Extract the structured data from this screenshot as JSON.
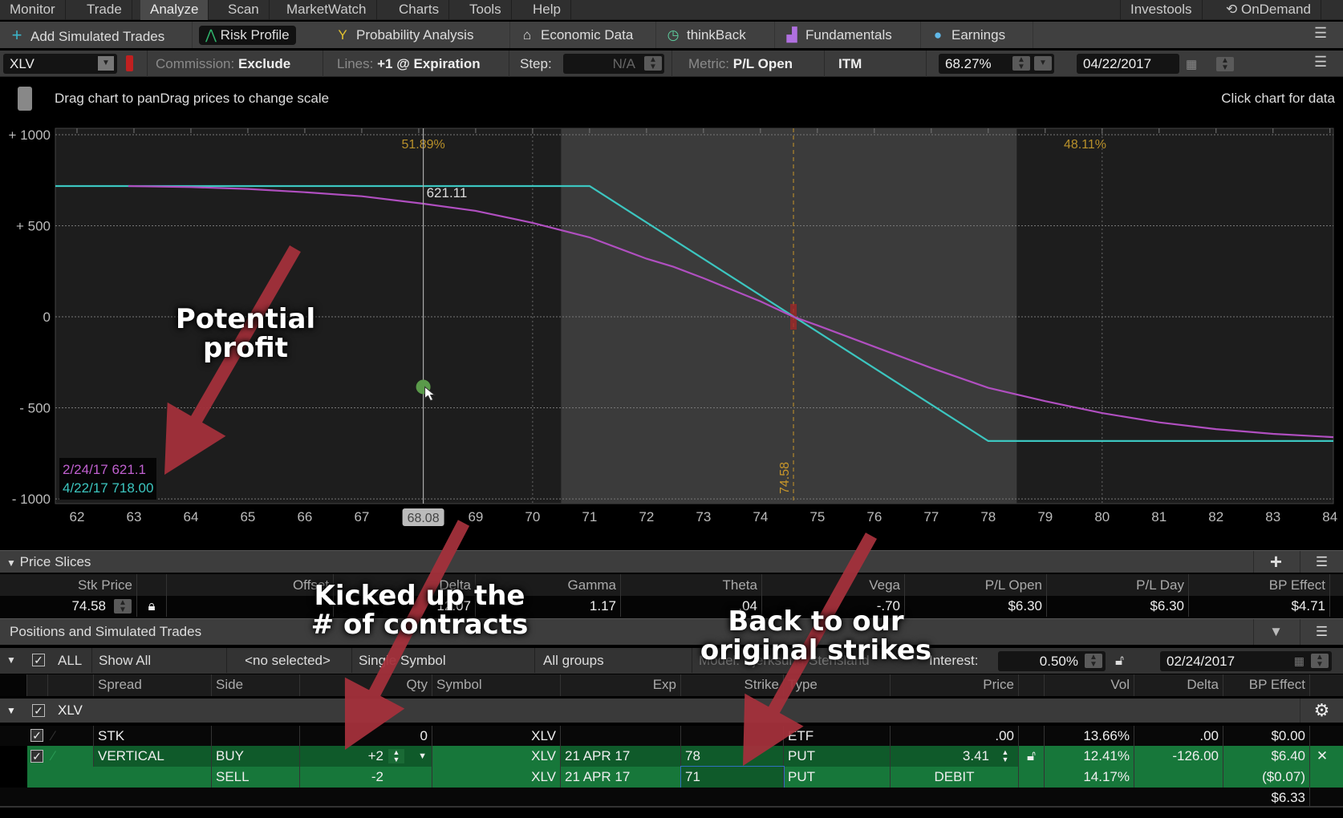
{
  "menu": {
    "tabs": [
      "Monitor",
      "Trade",
      "Analyze",
      "Scan",
      "MarketWatch",
      "Charts",
      "Tools",
      "Help"
    ],
    "active": "Analyze",
    "right": [
      "Investools",
      "OnDemand"
    ]
  },
  "toolbar": {
    "items": [
      "Add Simulated Trades",
      "Risk Profile",
      "Probability Analysis",
      "Economic Data",
      "thinkBack",
      "Fundamentals",
      "Earnings"
    ]
  },
  "options": {
    "symbol": "XLV",
    "commission_label": "Commission:",
    "commission_value": "Exclude",
    "lines_label": "Lines:",
    "lines_value": "+1 @ Expiration",
    "step_label": "Step:",
    "step_value": "N/A",
    "metric_label": "Metric:",
    "metric_value": "P/L Open",
    "itm": "ITM",
    "probability": "68.27%",
    "date": "04/22/2017"
  },
  "chart_header": {
    "hint": "Drag chart to panDrag prices to change scale",
    "right": "Click chart for data"
  },
  "chart_data": {
    "type": "line",
    "xlim": [
      61.62,
      84.06
    ],
    "ylim": [
      -1026,
      1035
    ],
    "x_ticks": [
      62,
      63,
      64,
      65,
      66,
      67,
      68,
      69,
      70,
      71,
      72,
      73,
      74,
      75,
      76,
      77,
      78,
      79,
      80,
      81,
      82,
      83,
      84
    ],
    "x_tick_labels": [
      "62",
      "63",
      "64",
      "65",
      "66",
      "67",
      "",
      "69",
      "70",
      "71",
      "72",
      "73",
      "74",
      "75",
      "76",
      "77",
      "78",
      "79",
      "80",
      "81",
      "82",
      "83",
      "84"
    ],
    "y_ticks": [
      1000,
      500,
      0,
      -500,
      -1000
    ],
    "y_tick_labels": [
      "+ 1000",
      "+ 500",
      "0",
      "- 500",
      "- 1000"
    ],
    "shaded_range": [
      70.5,
      78.5
    ],
    "grid_x": [
      70,
      80
    ],
    "stock_price": 74.58,
    "stock_price_label": "74.58",
    "crosshair_x": 68.08,
    "crosshair_label": "68.08",
    "crosshair_value_label": "621.11",
    "cursor_point": {
      "x": 68.08,
      "y": -385
    },
    "prob_labels": [
      {
        "x": 68.08,
        "text": "51.89%"
      },
      {
        "x": 79.7,
        "text": "48.11%"
      }
    ],
    "series": [
      {
        "name": "4/22/17",
        "color": "#3cc6c0",
        "x": [
          61.62,
          71,
          78,
          84.06
        ],
        "y": [
          718,
          718,
          -682,
          -682
        ]
      },
      {
        "name": "2/24/17",
        "color": "#b04fc0",
        "x": [
          62.9,
          64,
          65,
          66,
          67,
          68.08,
          69,
          70,
          71,
          72,
          72.47,
          73,
          74,
          74.58,
          75,
          76,
          77,
          78,
          79,
          80,
          81,
          82,
          83,
          84.06
        ],
        "y": [
          718,
          712,
          702,
          684,
          662,
          621,
          582,
          516,
          436,
          319,
          275,
          212,
          85,
          0,
          -47,
          -164,
          -281,
          -390,
          -463,
          -529,
          -580,
          -617,
          -643,
          -661
        ]
      }
    ],
    "legend": [
      {
        "text": "2/24/17 621.1",
        "color": "#c060d0"
      },
      {
        "text": "4/22/17 718.00",
        "color": "#3cc6c0"
      }
    ]
  },
  "price_slices": {
    "title": "Price Slices",
    "headers": [
      "Stk Price",
      "Offset",
      "Delta",
      "Gamma",
      "Theta",
      "Vega",
      "P/L Open",
      "P/L Day",
      "BP Effect"
    ],
    "values": {
      "stk_price": "74.58",
      "delta": "12.07",
      "gamma": "1.17",
      "theta": ".04",
      "vega": "-.70",
      "pl_open": "$6.30",
      "pl_day": "$6.30",
      "bp_effect": "$4.71"
    }
  },
  "positions": {
    "title": "Positions and Simulated Trades",
    "filters": {
      "all": "ALL",
      "show": "Show All",
      "selected": "<no selected>",
      "symbol": "Single Symbol",
      "groups": "All groups",
      "model": "Model: Bjerksund-Stensland",
      "interest_label": "Interest:",
      "interest": "0.50%",
      "date": "02/24/2017"
    },
    "headers": [
      "Spread",
      "Side",
      "Qty",
      "Symbol",
      "Exp",
      "Strike",
      "Type",
      "Price",
      "Vol",
      "Delta",
      "BP Effect"
    ],
    "group": "XLV",
    "rows": [
      {
        "spread": "STK",
        "side": "",
        "qty": "0",
        "symbol": "XLV",
        "exp": "",
        "strike": "",
        "type": "ETF",
        "price": ".00",
        "vol": "13.66%",
        "delta": ".00",
        "bp": "$0.00"
      },
      {
        "spread": "VERTICAL",
        "side": "BUY",
        "qty": "+2",
        "symbol": "XLV",
        "exp": "21 APR 17",
        "strike": "78",
        "type": "PUT",
        "price": "3.41",
        "vol": "12.41%",
        "delta": "-126.00",
        "bp": "$6.40"
      },
      {
        "spread": "",
        "side": "SELL",
        "qty": "-2",
        "symbol": "XLV",
        "exp": "21 APR 17",
        "strike": "71",
        "type": "PUT",
        "price": "DEBIT",
        "vol": "14.17%",
        "delta": "",
        "bp": "($0.07)"
      }
    ],
    "total_bp": "$6.33"
  },
  "annotations": {
    "potential_profit": [
      "Potential",
      "profit"
    ],
    "contracts": [
      "Kicked up the",
      "# of contracts"
    ],
    "strikes": [
      "Back to our",
      "original strikes"
    ],
    "arrow_color": "#a3303b"
  }
}
